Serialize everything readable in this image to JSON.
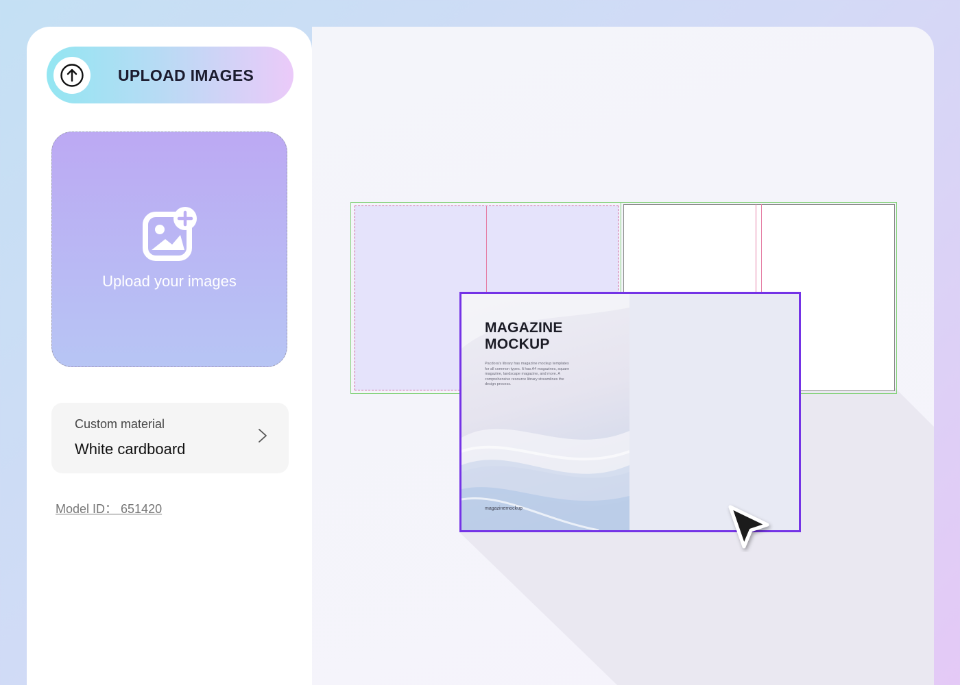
{
  "sidebar": {
    "upload_button_label": "UPLOAD IMAGES",
    "upload_button_icon": "arrow-up-circle-icon",
    "dropzone_text": "Upload your images",
    "dropzone_icon": "add-image-icon",
    "material": {
      "caption": "Custom material",
      "value": "White cardboard"
    },
    "model_id": "Model ID： 651420"
  },
  "preview": {
    "title_line1": "MAGAZINE",
    "title_line2": "MOCKUP",
    "description": "Pacdora's library has magazine mockup templates for all common types. It has A4 magazines, square magazine, landscape magazine, and more. A comprehensive resource library streamlines the design process.",
    "footer": "magazinemockup"
  },
  "colors": {
    "accent_purple": "#7433e6",
    "dieline_green": "#86d27c",
    "fold_pink": "#e57fa5"
  }
}
